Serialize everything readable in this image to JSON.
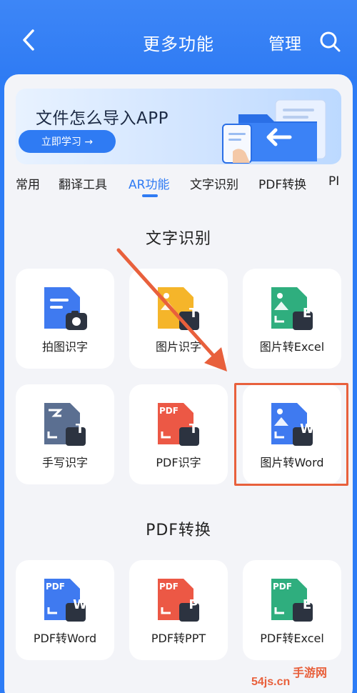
{
  "header": {
    "title": "更多功能",
    "manage_label": "管理"
  },
  "banner": {
    "title": "文件怎么导入APP",
    "button_label": "立即学习 →"
  },
  "tabs": [
    {
      "label": "常用"
    },
    {
      "label": "翻译工具"
    },
    {
      "label": "AR功能"
    },
    {
      "label": "文字识别"
    },
    {
      "label": "PDF转换"
    },
    {
      "label": "PI"
    }
  ],
  "active_tab": "AR功能",
  "sections": [
    {
      "title": "文字识别",
      "items": [
        {
          "label": "拍图识字",
          "icon": "photo-text-icon"
        },
        {
          "label": "图片识字",
          "icon": "image-text-icon"
        },
        {
          "label": "图片转Excel",
          "icon": "image-to-excel-icon"
        },
        {
          "label": "手写识字",
          "icon": "handwriting-text-icon"
        },
        {
          "label": "PDF识字",
          "icon": "pdf-text-icon"
        },
        {
          "label": "图片转Word",
          "icon": "image-to-word-icon"
        }
      ]
    },
    {
      "title": "PDF转换",
      "items": [
        {
          "label": "PDF转Word",
          "icon": "pdf-to-word-icon"
        },
        {
          "label": "PDF转PPT",
          "icon": "pdf-to-ppt-icon"
        },
        {
          "label": "PDF转Excel",
          "icon": "pdf-to-excel-icon"
        }
      ]
    }
  ],
  "icon_badges": {
    "t": "T",
    "e": "E",
    "w": "W",
    "p": "P",
    "pdf": "PDF"
  },
  "watermark": {
    "text": "54js.cn",
    "brand": "手游网"
  },
  "colors": {
    "accent": "#2f7bf3",
    "highlight": "#e8603c",
    "doc_blue": "#3f7af0",
    "doc_yellow": "#f5b52a",
    "doc_green": "#2fae7e",
    "doc_red": "#ec5845",
    "doc_slate": "#5b6f91"
  }
}
